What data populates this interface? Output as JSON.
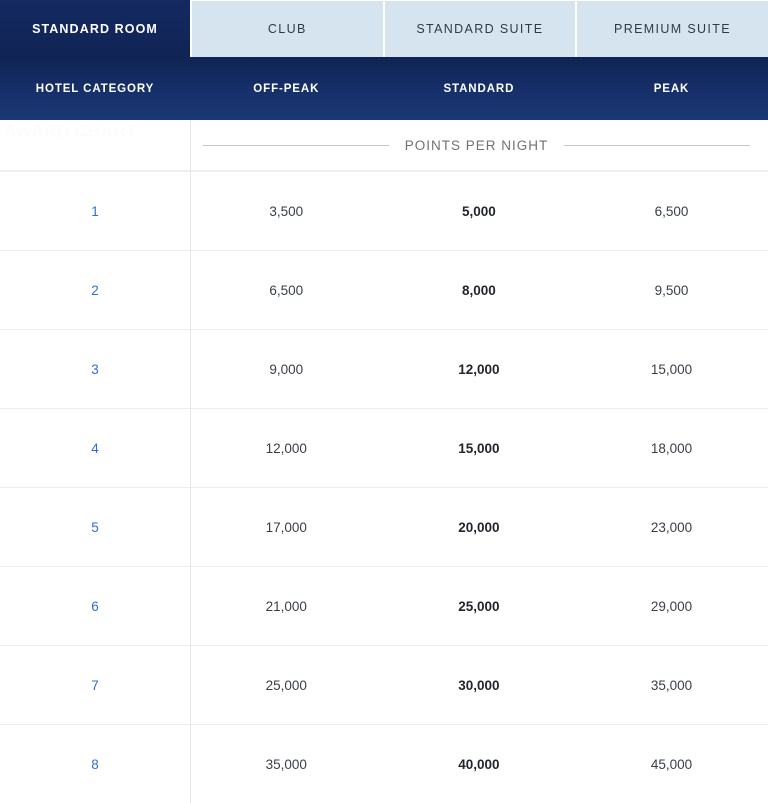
{
  "tabs": [
    {
      "label": "STANDARD ROOM",
      "active": true
    },
    {
      "label": "CLUB",
      "active": false
    },
    {
      "label": "STANDARD SUITE",
      "active": false
    },
    {
      "label": "PREMIUM SUITE",
      "active": false
    }
  ],
  "columns": [
    {
      "label": "HOTEL CATEGORY"
    },
    {
      "label": "OFF-PEAK"
    },
    {
      "label": "STANDARD"
    },
    {
      "label": "PEAK"
    }
  ],
  "section": {
    "points_label": "POINTS PER NIGHT",
    "watermark": "AWARD CHART"
  },
  "colors": {
    "header_navy": "#102454",
    "tab_inactive": "#d6e4ef",
    "category_link": "#2e6fd4",
    "rule": "#c4c7ca",
    "row_border": "#eceef0"
  },
  "rows": [
    {
      "category": "1",
      "off_peak": "3,500",
      "standard": "5,000",
      "peak": "6,500"
    },
    {
      "category": "2",
      "off_peak": "6,500",
      "standard": "8,000",
      "peak": "9,500"
    },
    {
      "category": "3",
      "off_peak": "9,000",
      "standard": "12,000",
      "peak": "15,000"
    },
    {
      "category": "4",
      "off_peak": "12,000",
      "standard": "15,000",
      "peak": "18,000"
    },
    {
      "category": "5",
      "off_peak": "17,000",
      "standard": "20,000",
      "peak": "23,000"
    },
    {
      "category": "6",
      "off_peak": "21,000",
      "standard": "25,000",
      "peak": "29,000"
    },
    {
      "category": "7",
      "off_peak": "25,000",
      "standard": "30,000",
      "peak": "35,000"
    },
    {
      "category": "8",
      "off_peak": "35,000",
      "standard": "40,000",
      "peak": "45,000"
    }
  ]
}
